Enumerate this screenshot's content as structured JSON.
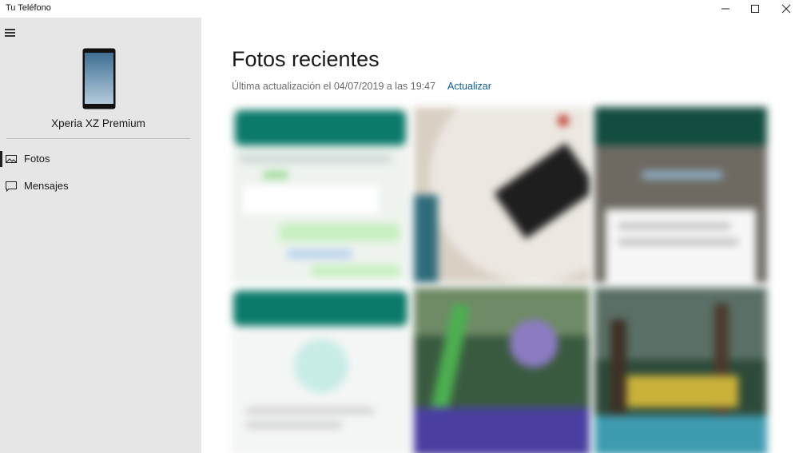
{
  "window": {
    "title": "Tu Teléfono",
    "controls": [
      "minimize-icon",
      "maximize-icon",
      "close-icon"
    ]
  },
  "sidebar": {
    "menu_icon": "hamburger-icon",
    "device": {
      "icon": "phone-icon",
      "name": "Xperia XZ Premium"
    },
    "items": [
      {
        "label": "Fotos",
        "icon": "photo-icon",
        "active": true
      },
      {
        "label": "Mensajes",
        "icon": "message-icon",
        "active": false
      }
    ]
  },
  "main": {
    "title": "Fotos recientes",
    "last_update": "Última actualización el 04/07/2019 a las 19:47",
    "update_link": "Actualizar",
    "photos": [
      {
        "name": "photo-1"
      },
      {
        "name": "photo-2"
      },
      {
        "name": "photo-3"
      },
      {
        "name": "photo-4"
      },
      {
        "name": "photo-5"
      },
      {
        "name": "photo-6"
      }
    ]
  },
  "colors": {
    "sidebar_bg": "#e6e6e6",
    "link": "#0a5fa0",
    "whatsapp_green": "#0b7a6a"
  }
}
